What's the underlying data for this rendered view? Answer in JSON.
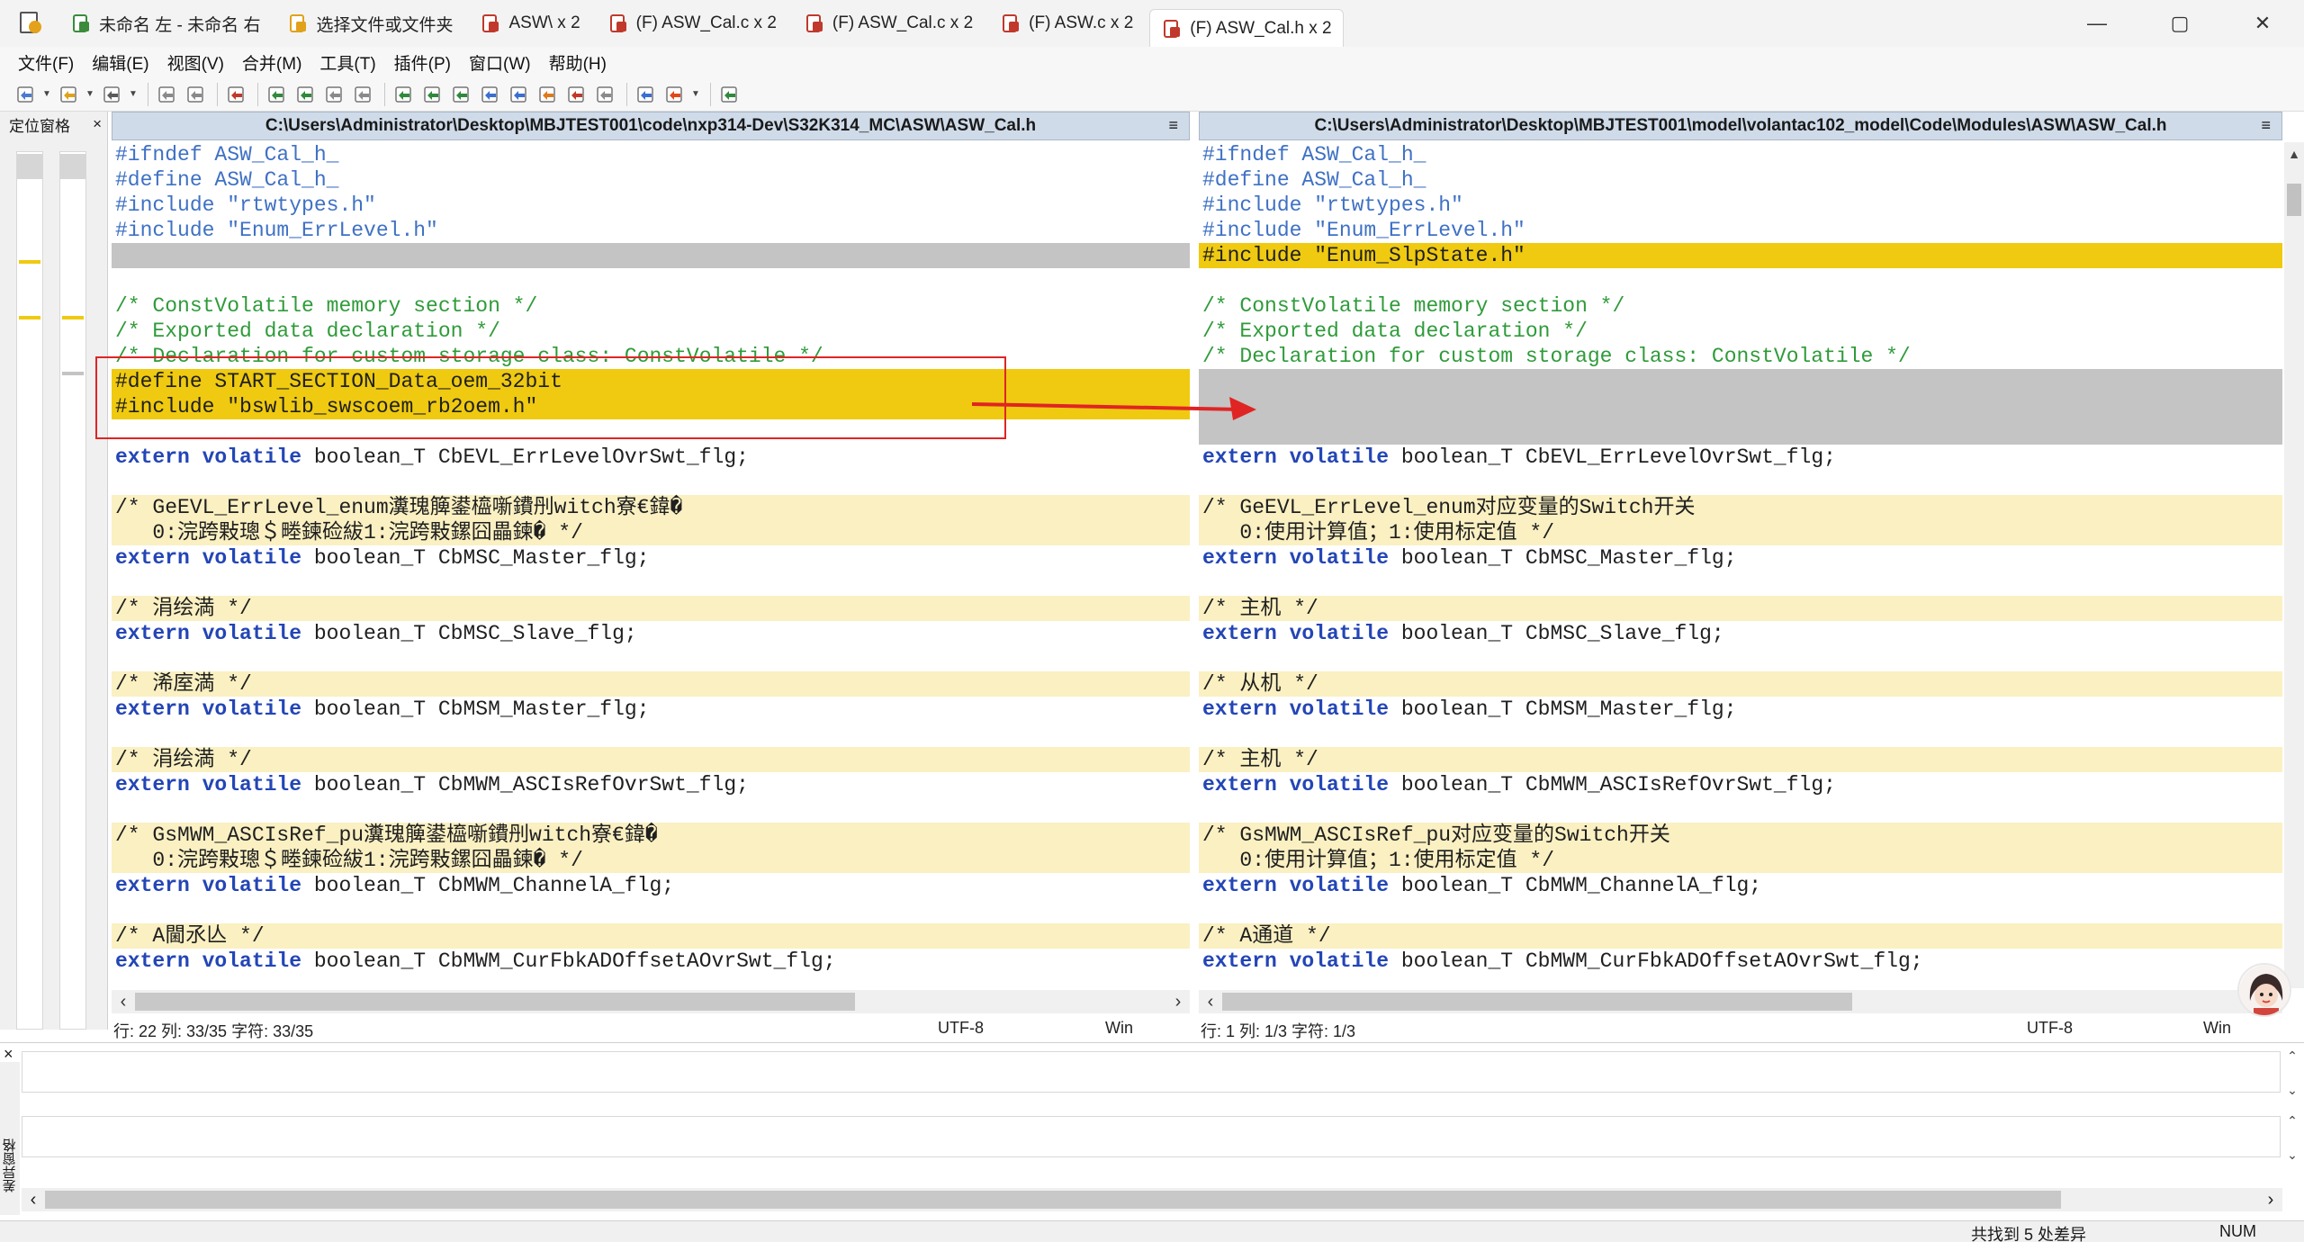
{
  "titlebar": {
    "tabs": [
      {
        "label": "未命名 左 - 未命名 右",
        "icon": "compare-app-icon",
        "active": false
      },
      {
        "label": "选择文件或文件夹",
        "icon": "open-folder-icon",
        "active": false
      },
      {
        "label": "ASW\\ x 2",
        "icon": "folder-compare-icon",
        "active": false
      },
      {
        "label": "(F) ASW_Cal.c x 2",
        "icon": "file-compare-icon",
        "active": false
      },
      {
        "label": "(F) ASW_Cal.c x 2",
        "icon": "file-compare-icon",
        "active": false
      },
      {
        "label": "(F) ASW.c x 2",
        "icon": "file-compare-icon",
        "active": false
      },
      {
        "label": "(F) ASW_Cal.h x 2",
        "icon": "file-compare-icon",
        "active": true
      }
    ],
    "controls": {
      "minimize": "—",
      "maximize": "▢",
      "close": "✕"
    }
  },
  "menu": [
    "文件(F)",
    "编辑(E)",
    "视图(V)",
    "合并(M)",
    "工具(T)",
    "插件(P)",
    "窗口(W)",
    "帮助(H)"
  ],
  "toolbar": {
    "buttons": [
      "new-icon",
      "open-icon",
      "save-icon",
      "undo-icon",
      "redo-icon",
      "filter-icon",
      "copy-left-icon",
      "copy-right-icon",
      "merge-all-left-icon",
      "merge-all-right-icon",
      "next-diff-icon",
      "prev-diff-icon",
      "first-diff-icon",
      "last-diff-icon",
      "next-conflict-icon",
      "prev-conflict-icon",
      "goto-icon",
      "toggle-icon",
      "select-icon",
      "options-icon",
      "refresh-icon"
    ],
    "accent": "#2f8a3b"
  },
  "locator": {
    "title": "定位窗格",
    "close": "×"
  },
  "left": {
    "path": "C:\\Users\\Administrator\\Desktop\\MBJTEST001\\code\\nxp314-Dev\\S32K314_MC\\ASW\\ASW_Cal.h",
    "menu": "≡",
    "lines": [
      {
        "bg": "none",
        "segs": [
          {
            "c": "pp",
            "t": "#ifndef ASW_Cal_h_"
          }
        ]
      },
      {
        "bg": "none",
        "segs": [
          {
            "c": "pp",
            "t": "#define ASW_Cal_h_"
          }
        ]
      },
      {
        "bg": "none",
        "segs": [
          {
            "c": "pp",
            "t": "#include \"rtwtypes.h\""
          }
        ]
      },
      {
        "bg": "none",
        "segs": [
          {
            "c": "pp",
            "t": "#include \"Enum_ErrLevel.h\""
          }
        ]
      },
      {
        "bg": "missing",
        "segs": []
      },
      {
        "bg": "none",
        "segs": []
      },
      {
        "bg": "none",
        "segs": [
          {
            "c": "comment",
            "t": "/* ConstVolatile memory section */"
          }
        ]
      },
      {
        "bg": "none",
        "segs": [
          {
            "c": "comment",
            "t": "/* Exported data declaration */"
          }
        ]
      },
      {
        "bg": "none",
        "segs": [
          {
            "c": "comment",
            "t": "/* Declaration for custom storage class: ConstVolatile */"
          }
        ]
      },
      {
        "bg": "diff",
        "segs": [
          {
            "c": "plain",
            "t": "#define START_SECTION_Data_oem_32bit"
          }
        ]
      },
      {
        "bg": "diff",
        "segs": [
          {
            "c": "plain",
            "t": "#include \"bswlib_swscoem_rb2oem.h\""
          }
        ]
      },
      {
        "bg": "none",
        "segs": []
      },
      {
        "bg": "none",
        "segs": [
          {
            "c": "kw",
            "t": "extern volatile"
          },
          {
            "c": "plain",
            "t": " boolean_T CbEVL_ErrLevelOvrSwt_flg;"
          }
        ]
      },
      {
        "bg": "none",
        "segs": []
      },
      {
        "bg": "sim",
        "segs": [
          {
            "c": "plain",
            "t": "/* GeEVL_ErrLevel_enum瀵瑰簲鍙橀噺鐨刐witch寮€鍏�"
          }
        ]
      },
      {
        "bg": "sim",
        "segs": [
          {
            "c": "plain",
            "t": "   0:浣跨敤璁＄畻鍊硷紱1:浣跨敤鏍囧畾鍊� */"
          }
        ]
      },
      {
        "bg": "none",
        "segs": [
          {
            "c": "kw",
            "t": "extern volatile"
          },
          {
            "c": "plain",
            "t": " boolean_T CbMSC_Master_flg;"
          }
        ]
      },
      {
        "bg": "none",
        "segs": []
      },
      {
        "bg": "sim",
        "segs": [
          {
            "c": "plain",
            "t": "/* 涓绘満 */"
          }
        ]
      },
      {
        "bg": "none",
        "segs": [
          {
            "c": "kw",
            "t": "extern volatile"
          },
          {
            "c": "plain",
            "t": " boolean_T CbMSC_Slave_flg;"
          }
        ]
      },
      {
        "bg": "none",
        "segs": []
      },
      {
        "bg": "sim",
        "segs": [
          {
            "c": "plain",
            "t": "/* 浠庢満 */"
          }
        ]
      },
      {
        "bg": "none",
        "segs": [
          {
            "c": "kw",
            "t": "extern volatile"
          },
          {
            "c": "plain",
            "t": " boolean_T CbMSM_Master_flg;"
          }
        ]
      },
      {
        "bg": "none",
        "segs": []
      },
      {
        "bg": "sim",
        "segs": [
          {
            "c": "plain",
            "t": "/* 涓绘満 */"
          }
        ]
      },
      {
        "bg": "none",
        "segs": [
          {
            "c": "kw",
            "t": "extern volatile"
          },
          {
            "c": "plain",
            "t": " boolean_T CbMWM_ASCIsRefOvrSwt_flg;"
          }
        ]
      },
      {
        "bg": "none",
        "segs": []
      },
      {
        "bg": "sim",
        "segs": [
          {
            "c": "plain",
            "t": "/* GsMWM_ASCIsRef_pu瀵瑰簲鍙橀噺鐨刐witch寮€鍏�"
          }
        ]
      },
      {
        "bg": "sim",
        "segs": [
          {
            "c": "plain",
            "t": "   0:浣跨敤璁＄畻鍊硷紱1:浣跨敤鏍囧畾鍊� */"
          }
        ]
      },
      {
        "bg": "none",
        "segs": [
          {
            "c": "kw",
            "t": "extern volatile"
          },
          {
            "c": "plain",
            "t": " boolean_T CbMWM_ChannelA_flg;"
          }
        ]
      },
      {
        "bg": "none",
        "segs": []
      },
      {
        "bg": "sim",
        "segs": [
          {
            "c": "plain",
            "t": "/* A閫氶亾 */"
          }
        ]
      },
      {
        "bg": "none",
        "segs": [
          {
            "c": "kw",
            "t": "extern volatile"
          },
          {
            "c": "plain",
            "t": " boolean_T CbMWM_CurFbkADOffsetAOvrSwt_flg;"
          }
        ]
      }
    ],
    "status": {
      "pos": "行: 22  列: 33/35  字符: 33/35",
      "encoding": "UTF-8",
      "eol": "Win"
    }
  },
  "right": {
    "path": "C:\\Users\\Administrator\\Desktop\\MBJTEST001\\model\\volantac102_model\\Code\\Modules\\ASW\\ASW_Cal.h",
    "menu": "≡",
    "lines": [
      {
        "bg": "none",
        "segs": [
          {
            "c": "pp",
            "t": "#ifndef ASW_Cal_h_"
          }
        ]
      },
      {
        "bg": "none",
        "segs": [
          {
            "c": "pp",
            "t": "#define ASW_Cal_h_"
          }
        ]
      },
      {
        "bg": "none",
        "segs": [
          {
            "c": "pp",
            "t": "#include \"rtwtypes.h\""
          }
        ]
      },
      {
        "bg": "none",
        "segs": [
          {
            "c": "pp",
            "t": "#include \"Enum_ErrLevel.h\""
          }
        ]
      },
      {
        "bg": "diff",
        "segs": [
          {
            "c": "plain",
            "t": "#include \"Enum_SlpState.h\""
          }
        ]
      },
      {
        "bg": "none",
        "segs": []
      },
      {
        "bg": "none",
        "segs": [
          {
            "c": "comment",
            "t": "/* ConstVolatile memory section */"
          }
        ]
      },
      {
        "bg": "none",
        "segs": [
          {
            "c": "comment",
            "t": "/* Exported data declaration */"
          }
        ]
      },
      {
        "bg": "none",
        "segs": [
          {
            "c": "comment",
            "t": "/* Declaration for custom storage class: ConstVolatile */"
          }
        ]
      },
      {
        "bg": "missing",
        "segs": []
      },
      {
        "bg": "missing",
        "segs": []
      },
      {
        "bg": "missing",
        "segs": []
      },
      {
        "bg": "none",
        "segs": [
          {
            "c": "kw",
            "t": "extern volatile"
          },
          {
            "c": "plain",
            "t": " boolean_T CbEVL_ErrLevelOvrSwt_flg;"
          }
        ]
      },
      {
        "bg": "none",
        "segs": []
      },
      {
        "bg": "sim",
        "segs": [
          {
            "c": "plain",
            "t": "/* GeEVL_ErrLevel_enum对应变量的Switch开关"
          }
        ]
      },
      {
        "bg": "sim",
        "segs": [
          {
            "c": "plain",
            "t": "   0:使用计算值；1:使用标定值 */"
          }
        ]
      },
      {
        "bg": "none",
        "segs": [
          {
            "c": "kw",
            "t": "extern volatile"
          },
          {
            "c": "plain",
            "t": " boolean_T CbMSC_Master_flg;"
          }
        ]
      },
      {
        "bg": "none",
        "segs": []
      },
      {
        "bg": "sim",
        "segs": [
          {
            "c": "plain",
            "t": "/* 主机 */"
          }
        ]
      },
      {
        "bg": "none",
        "segs": [
          {
            "c": "kw",
            "t": "extern volatile"
          },
          {
            "c": "plain",
            "t": " boolean_T CbMSC_Slave_flg;"
          }
        ]
      },
      {
        "bg": "none",
        "segs": []
      },
      {
        "bg": "sim",
        "segs": [
          {
            "c": "plain",
            "t": "/* 从机 */"
          }
        ]
      },
      {
        "bg": "none",
        "segs": [
          {
            "c": "kw",
            "t": "extern volatile"
          },
          {
            "c": "plain",
            "t": " boolean_T CbMSM_Master_flg;"
          }
        ]
      },
      {
        "bg": "none",
        "segs": []
      },
      {
        "bg": "sim",
        "segs": [
          {
            "c": "plain",
            "t": "/* 主机 */"
          }
        ]
      },
      {
        "bg": "none",
        "segs": [
          {
            "c": "kw",
            "t": "extern volatile"
          },
          {
            "c": "plain",
            "t": " boolean_T CbMWM_ASCIsRefOvrSwt_flg;"
          }
        ]
      },
      {
        "bg": "none",
        "segs": []
      },
      {
        "bg": "sim",
        "segs": [
          {
            "c": "plain",
            "t": "/* GsMWM_ASCIsRef_pu对应变量的Switch开关"
          }
        ]
      },
      {
        "bg": "sim",
        "segs": [
          {
            "c": "plain",
            "t": "   0:使用计算值；1:使用标定值 */"
          }
        ]
      },
      {
        "bg": "none",
        "segs": [
          {
            "c": "kw",
            "t": "extern volatile"
          },
          {
            "c": "plain",
            "t": " boolean_T CbMWM_ChannelA_flg;"
          }
        ]
      },
      {
        "bg": "none",
        "segs": []
      },
      {
        "bg": "sim",
        "segs": [
          {
            "c": "plain",
            "t": "/* A通道 */"
          }
        ]
      },
      {
        "bg": "none",
        "segs": [
          {
            "c": "kw",
            "t": "extern volatile"
          },
          {
            "c": "plain",
            "t": " boolean_T CbMWM_CurFbkADOffsetAOvrSwt_flg;"
          }
        ]
      }
    ],
    "status": {
      "pos": "行: 1  列: 1/3  字符: 1/3",
      "encoding": "UTF-8",
      "eol": "Win"
    }
  },
  "diff_pane": {
    "title": "差异窗格",
    "close": "×"
  },
  "statusbar": {
    "diff_count": "共找到 5 处差异",
    "num": "NUM"
  },
  "colors": {
    "diff": "#efca10",
    "missing": "#c4c4c4",
    "similar": "#faf0c2",
    "annotation": "#e02424"
  }
}
